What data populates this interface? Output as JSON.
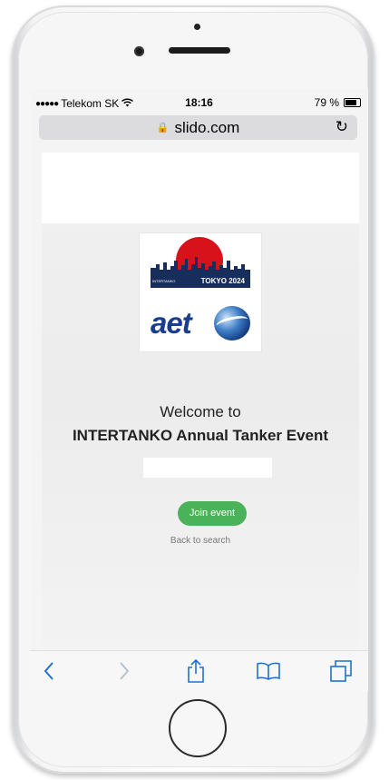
{
  "status_bar": {
    "signal": "●●●●●",
    "carrier": "Telekom SK",
    "wifi_icon": "wifi-icon",
    "time": "18:16",
    "battery": "79 %"
  },
  "browser": {
    "url": "slido.com",
    "lock_icon": "lock-icon",
    "reload_icon": "reload-icon"
  },
  "logo": {
    "band_text": "TOKYO 2024",
    "mini_text": "INTERTANKO",
    "aet_text": "aet"
  },
  "main": {
    "welcome": "Welcome to",
    "event_name": "INTERTANKO Annual Tanker Event",
    "join_button": "Join event",
    "back_link": "Back to search"
  },
  "toolbar": {
    "items": [
      "back-icon",
      "forward-icon",
      "share-icon",
      "bookmarks-icon",
      "tabs-icon"
    ],
    "accent": "#1f72d1"
  },
  "colors": {
    "join_green": "#4ab258",
    "logo_red": "#d8121b",
    "logo_navy": "#172d5c",
    "aet_blue": "#1b3d8f"
  }
}
